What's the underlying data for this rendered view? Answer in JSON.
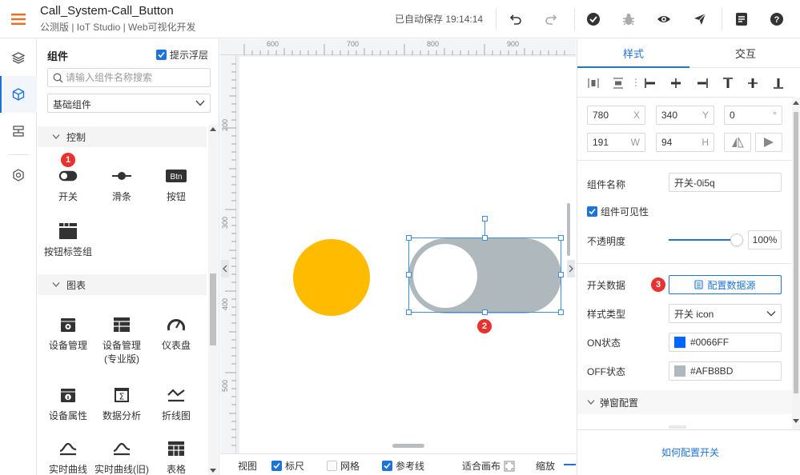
{
  "header": {
    "title": "Call_System-Call_Button",
    "subtitle": "公测版 | IoT Studio | Web可视化开发",
    "autosave": "已自动保存 19:14:14",
    "icons": [
      "undo-icon",
      "redo-icon",
      "check-icon",
      "debug-icon",
      "preview-icon",
      "publish-icon",
      "document-icon",
      "help-icon"
    ]
  },
  "rail": {
    "items": [
      "layers-icon",
      "components-icon",
      "pages-icon",
      "settings-icon"
    ],
    "active": "components-icon"
  },
  "panel": {
    "title": "组件",
    "hint_label": "提示浮层",
    "search_placeholder": "请输入组件名称搜索",
    "category": "基础组件",
    "groups": [
      {
        "name": "控制",
        "items": [
          {
            "label": "开关",
            "icon": "switch-icon"
          },
          {
            "label": "滑条",
            "icon": "slider-icon"
          },
          {
            "label": "按钮",
            "icon": "button-icon",
            "icon_text": "Btn"
          },
          {
            "label": "按钮标签组",
            "icon": "button-group-icon"
          }
        ]
      },
      {
        "name": "图表",
        "items": [
          {
            "label": "设备管理",
            "icon": "device-manage-icon"
          },
          {
            "label": "设备管理\n(专业版)",
            "icon": "device-manage-pro-icon"
          },
          {
            "label": "仪表盘",
            "icon": "gauge-icon"
          },
          {
            "label": "设备属性",
            "icon": "device-attr-icon"
          },
          {
            "label": "数据分析",
            "icon": "data-analysis-icon"
          },
          {
            "label": "折线图",
            "icon": "line-chart-icon"
          },
          {
            "label": "实时曲线",
            "icon": "realtime-curve-icon"
          },
          {
            "label": "实时曲线(旧)",
            "icon": "realtime-curve-old-icon"
          },
          {
            "label": "表格",
            "icon": "table-icon"
          }
        ]
      }
    ]
  },
  "badges": {
    "one": "1",
    "two": "2",
    "three": "3"
  },
  "canvas": {
    "ruler_top": [
      "600",
      "700",
      "800",
      "900"
    ],
    "ruler_left": [
      "200",
      "300",
      "400",
      "500"
    ],
    "circle_color": "#FFBB00",
    "switch_off_color": "#AFB8BD"
  },
  "bottom_bar": {
    "view_label": "视图",
    "ruler_label": "标尺",
    "grid_label": "网格",
    "guides_label": "参考线",
    "fit_label": "适合画布",
    "zoom_label": "缩放"
  },
  "props": {
    "tab_style": "样式",
    "tab_interact": "交互",
    "x": "780",
    "x_unit": "X",
    "y": "340",
    "y_unit": "Y",
    "rotation": "0",
    "rotation_unit": "°",
    "w": "191",
    "w_unit": "W",
    "h": "94",
    "h_unit": "H",
    "name_label": "组件名称",
    "name_value": "开关-0i5q",
    "visible_label": "组件可见性",
    "opacity_label": "不透明度",
    "opacity_value": "100%",
    "switch_data_label": "开关数据",
    "config_data_button": "配置数据源",
    "style_type_label": "样式类型",
    "style_type_value": "开关 icon",
    "on_label": "ON状态",
    "on_color": "#0066FF",
    "off_label": "OFF状态",
    "off_color": "#AFB8BD",
    "popup_label": "弹窗配置",
    "help_link": "如何配置开关"
  }
}
